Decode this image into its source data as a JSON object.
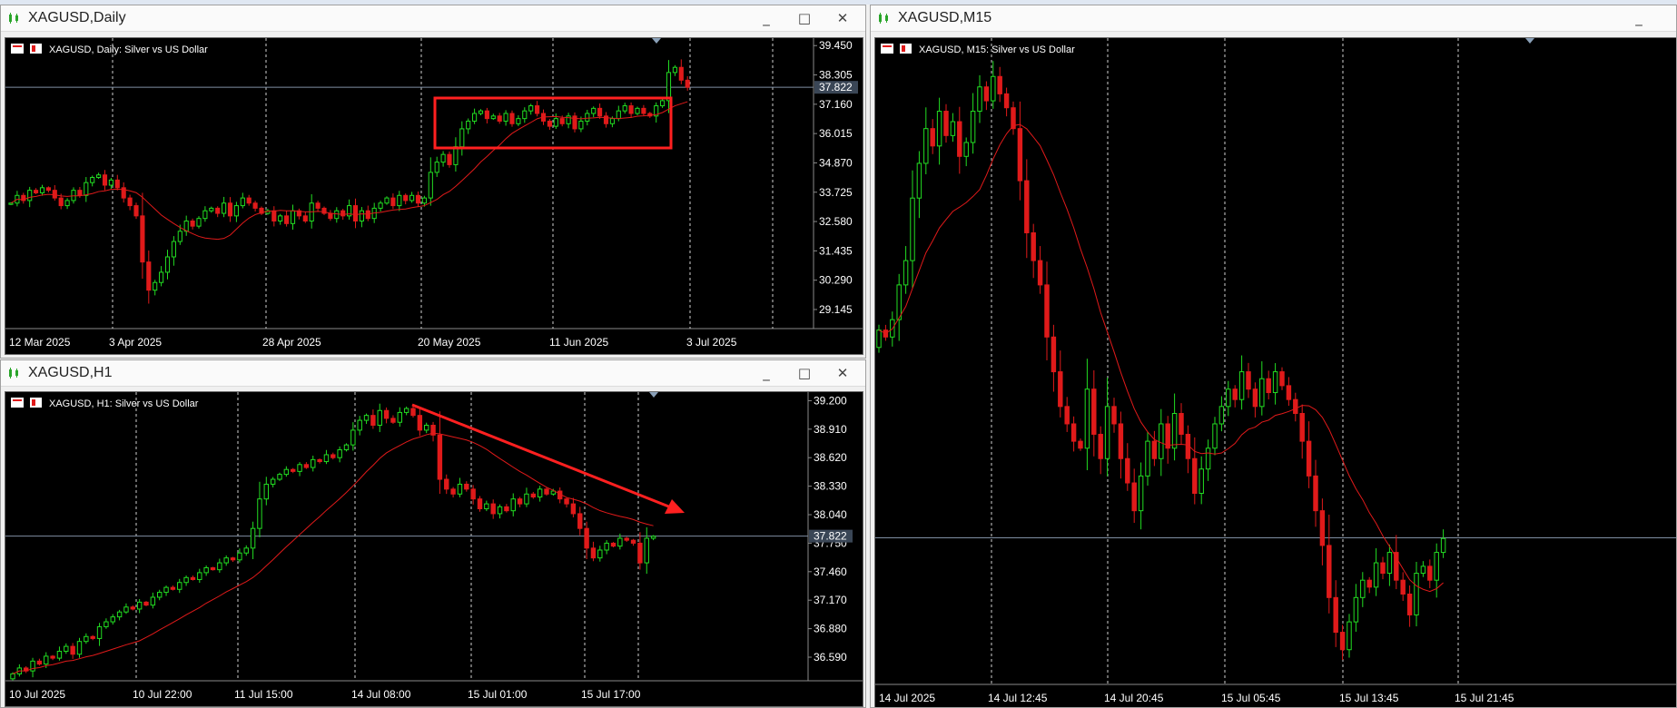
{
  "windows": {
    "daily": {
      "title": "XAGUSD,Daily",
      "chart_label": "XAGUSD, Daily:  Silver vs US Dollar",
      "window_buttons": {
        "minimize": "_",
        "maximize": "□",
        "close": "✕"
      },
      "chart_data": {
        "type": "candlestick",
        "symbol": "XAGUSD",
        "timeframe": "Daily",
        "price_ticks": [
          "39.450",
          "38.305",
          "37.160",
          "36.015",
          "34.870",
          "33.725",
          "32.580",
          "31.435",
          "30.290",
          "29.145"
        ],
        "date_ticks": [
          "12 Mar 2025",
          "3 Apr 2025",
          "28 Apr 2025",
          "20 May 2025",
          "11 Jun 2025",
          "3 Jul 2025"
        ],
        "current_price": "37.822",
        "ylim": [
          28.4,
          39.6
        ],
        "close": [
          33.3,
          33.6,
          33.4,
          33.8,
          33.7,
          33.9,
          33.8,
          33.5,
          33.2,
          33.4,
          33.8,
          33.6,
          34.1,
          34.3,
          34.4,
          34.0,
          34.2,
          33.9,
          33.5,
          33.2,
          32.8,
          31.0,
          29.9,
          30.2,
          30.6,
          31.2,
          31.8,
          32.2,
          32.6,
          32.4,
          32.7,
          33.0,
          33.1,
          32.9,
          33.3,
          32.8,
          33.2,
          33.5,
          33.3,
          33.1,
          32.9,
          33.0,
          32.6,
          32.8,
          32.5,
          33.0,
          32.8,
          32.6,
          33.3,
          33.1,
          32.9,
          32.7,
          33.0,
          32.8,
          33.2,
          32.6,
          33.0,
          32.7,
          33.1,
          33.3,
          33.5,
          33.2,
          33.6,
          33.4,
          33.6,
          33.3,
          33.5,
          34.5,
          34.9,
          35.2,
          34.8,
          35.5,
          36.2,
          36.5,
          36.8,
          36.9,
          36.6,
          36.7,
          36.5,
          36.8,
          36.4,
          36.6,
          36.9,
          37.1,
          36.8,
          36.5,
          36.3,
          36.6,
          36.4,
          36.7,
          36.2,
          36.5,
          36.8,
          37.0,
          36.7,
          36.4,
          36.6,
          36.9,
          37.1,
          36.8,
          37.0,
          36.8,
          36.7,
          37.1,
          37.3,
          38.4,
          38.6,
          38.1,
          37.822
        ],
        "overlay": "moving average (red)",
        "annotation": "red rectangle around Jun–Jul 2025 consolidation"
      }
    },
    "h1": {
      "title": "XAGUSD,H1",
      "chart_label": "XAGUSD, H1:  Silver vs US Dollar",
      "window_buttons": {
        "minimize": "_",
        "maximize": "□",
        "close": "✕"
      },
      "chart_data": {
        "type": "candlestick",
        "symbol": "XAGUSD",
        "timeframe": "H1",
        "price_ticks": [
          "39.200",
          "38.910",
          "38.620",
          "38.330",
          "38.040",
          "37.750",
          "37.460",
          "37.170",
          "36.880",
          "36.590"
        ],
        "date_ticks": [
          "10 Jul 2025",
          "10 Jul 22:00",
          "11 Jul 15:00",
          "14 Jul 08:00",
          "15 Jul 01:00",
          "15 Jul 17:00"
        ],
        "current_price": "37.822",
        "ylim": [
          36.35,
          39.25
        ],
        "close": [
          36.42,
          36.48,
          36.45,
          36.55,
          36.52,
          36.6,
          36.58,
          36.65,
          36.7,
          36.62,
          36.75,
          36.8,
          36.78,
          36.9,
          36.95,
          37.0,
          37.05,
          37.1,
          37.08,
          37.15,
          37.12,
          37.2,
          37.25,
          37.3,
          37.28,
          37.35,
          37.4,
          37.38,
          37.45,
          37.5,
          37.48,
          37.55,
          37.6,
          37.58,
          37.65,
          37.7,
          37.9,
          38.2,
          38.35,
          38.4,
          38.45,
          38.5,
          38.48,
          38.55,
          38.52,
          38.6,
          38.58,
          38.65,
          38.62,
          38.7,
          38.75,
          38.9,
          39.0,
          39.05,
          38.95,
          39.1,
          39.02,
          38.98,
          39.08,
          39.12,
          39.05,
          38.9,
          38.95,
          38.85,
          38.4,
          38.3,
          38.25,
          38.35,
          38.3,
          38.2,
          38.1,
          38.15,
          38.05,
          38.12,
          38.08,
          38.2,
          38.15,
          38.25,
          38.22,
          38.3,
          38.25,
          38.28,
          38.2,
          38.15,
          38.05,
          37.9,
          37.7,
          37.6,
          37.68,
          37.75,
          37.72,
          37.8,
          37.78,
          37.75,
          37.55,
          37.8,
          37.82
        ],
        "overlay": "moving average (red)",
        "annotation": "red arrow indicating downtrend"
      }
    },
    "m15": {
      "title": "XAGUSD,M15",
      "chart_label": "XAGUSD, M15:  Silver vs US Dollar",
      "window_buttons": {
        "minimize": "_"
      },
      "chart_data": {
        "type": "candlestick",
        "symbol": "XAGUSD",
        "timeframe": "M15",
        "date_ticks": [
          "14 Jul 2025",
          "14 Jul 12:45",
          "14 Jul 20:45",
          "15 Jul 05:45",
          "15 Jul 13:45",
          "15 Jul 21:45"
        ],
        "current_price": "37.822",
        "ylim": [
          37.4,
          39.25
        ],
        "close": [
          38.42,
          38.4,
          38.45,
          38.55,
          38.62,
          38.8,
          38.9,
          39.0,
          38.95,
          39.05,
          38.98,
          39.02,
          38.92,
          38.96,
          39.05,
          39.12,
          39.08,
          39.15,
          39.1,
          39.06,
          39.0,
          38.85,
          38.7,
          38.62,
          38.55,
          38.4,
          38.3,
          38.2,
          38.15,
          38.1,
          38.08,
          38.25,
          38.12,
          38.05,
          38.2,
          38.15,
          38.05,
          37.98,
          37.9,
          38.0,
          38.1,
          38.05,
          38.15,
          38.08,
          38.18,
          38.12,
          38.05,
          37.95,
          38.02,
          38.08,
          38.15,
          38.2,
          38.25,
          38.22,
          38.3,
          38.25,
          38.2,
          38.28,
          38.24,
          38.3,
          38.26,
          38.22,
          38.18,
          38.1,
          38.0,
          37.9,
          37.8,
          37.65,
          37.55,
          37.5,
          37.58,
          37.65,
          37.7,
          37.68,
          37.75,
          37.72,
          37.78,
          37.7,
          37.66,
          37.6,
          37.72,
          37.74,
          37.7,
          37.78,
          37.82
        ],
        "overlay": "moving average (red)"
      }
    }
  }
}
